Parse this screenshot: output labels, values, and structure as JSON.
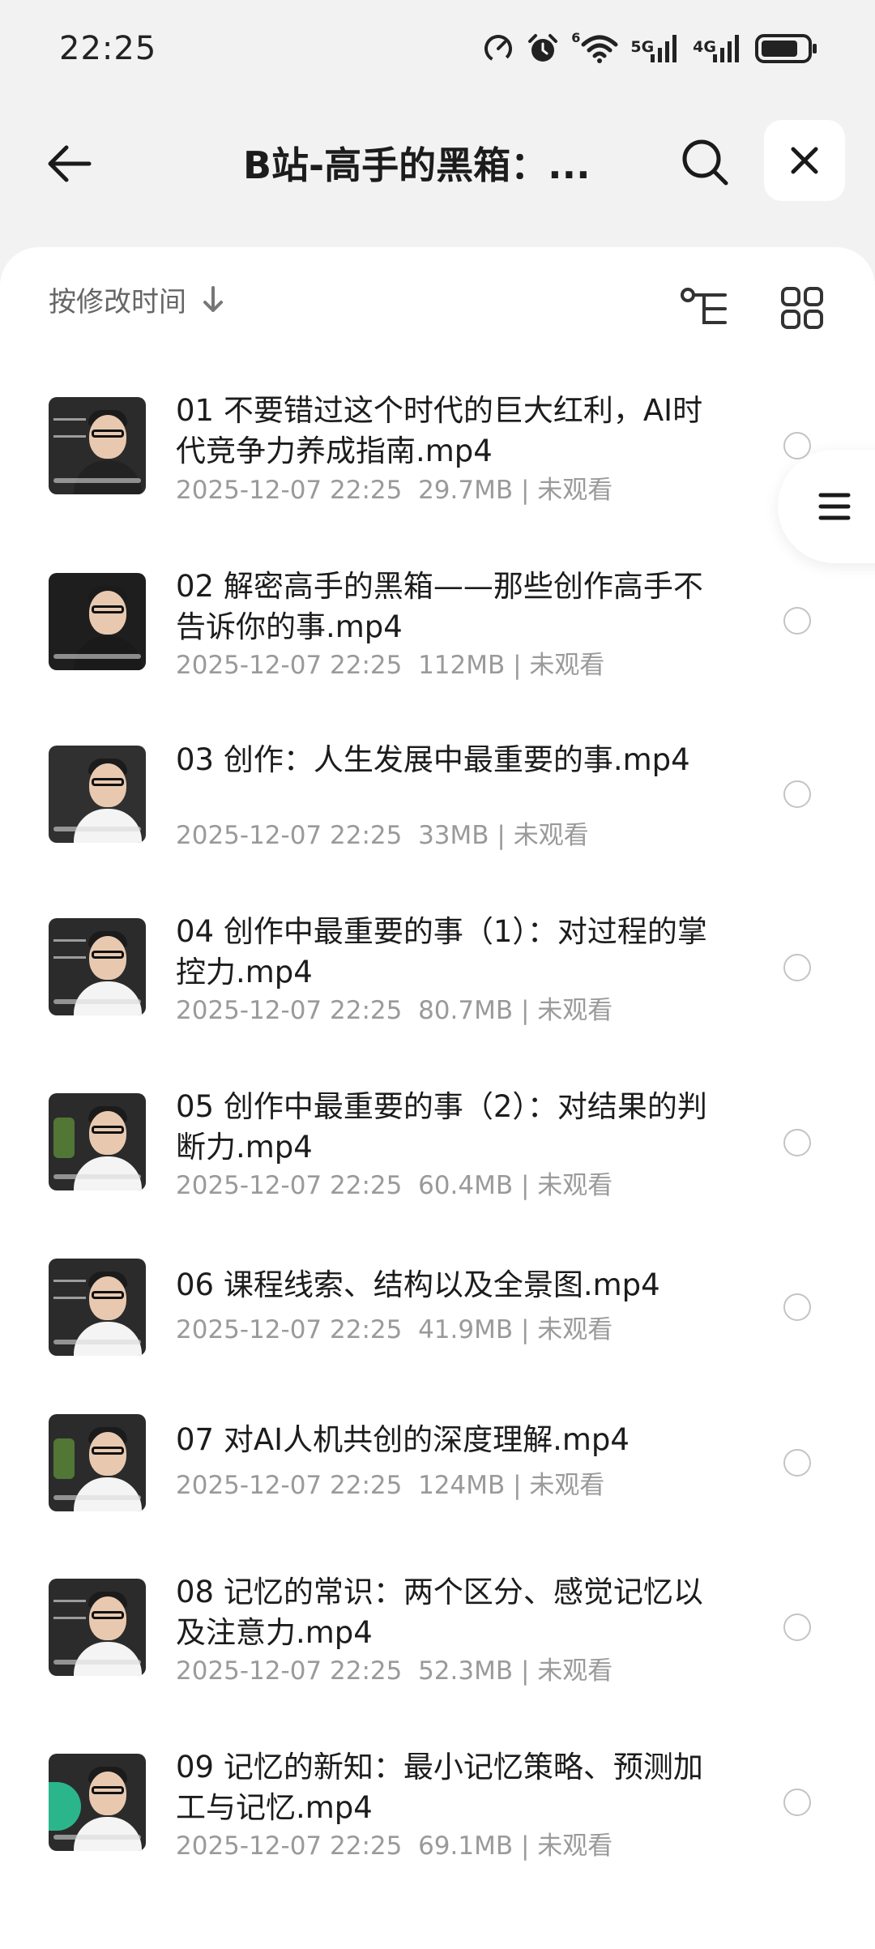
{
  "status_bar": {
    "time": "22:25",
    "net1": "5G",
    "net2": "4G",
    "wifi_sup": "6"
  },
  "header": {
    "title": "B站-高手的黑箱：..."
  },
  "toolbar": {
    "sort_label": "按修改时间"
  },
  "files": [
    {
      "title": "01 不要错过这个时代的巨大红利，AI时代竞争力养成指南.mp4",
      "date": "2025-12-07 22:25",
      "size": "29.7MB",
      "status": "未观看"
    },
    {
      "title": "02 解密高手的黑箱——那些创作高手不告诉你的事.mp4",
      "date": "2025-12-07 22:25",
      "size": "112MB",
      "status": "未观看"
    },
    {
      "title": "03 创作：人生发展中最重要的事.mp4",
      "date": "2025-12-07 22:25",
      "size": "33MB",
      "status": "未观看"
    },
    {
      "title": "04 创作中最重要的事（1）：对过程的掌控力.mp4",
      "date": "2025-12-07 22:25",
      "size": "80.7MB",
      "status": "未观看"
    },
    {
      "title": "05 创作中最重要的事（2）：对结果的判断力.mp4",
      "date": "2025-12-07 22:25",
      "size": "60.4MB",
      "status": "未观看"
    },
    {
      "title": "06 课程线索、结构以及全景图.mp4",
      "date": "2025-12-07 22:25",
      "size": "41.9MB",
      "status": "未观看"
    },
    {
      "title": "07 对AI人机共创的深度理解.mp4",
      "date": "2025-12-07 22:25",
      "size": "124MB",
      "status": "未观看"
    },
    {
      "title": "08 记忆的常识：两个区分、感觉记忆以及注意力.mp4",
      "date": "2025-12-07 22:25",
      "size": "52.3MB",
      "status": "未观看"
    },
    {
      "title": "09 记忆的新知：最小记忆策略、预测加工与记忆.mp4",
      "date": "2025-12-07 22:25",
      "size": "69.1MB",
      "status": "未观看"
    }
  ],
  "icons": {
    "back": "arrow-left-icon",
    "search": "search-icon",
    "close": "close-icon",
    "sort": "arrow-down-icon",
    "tree": "tree-view-icon",
    "grid": "grid-view-icon",
    "menu": "menu-icon"
  }
}
